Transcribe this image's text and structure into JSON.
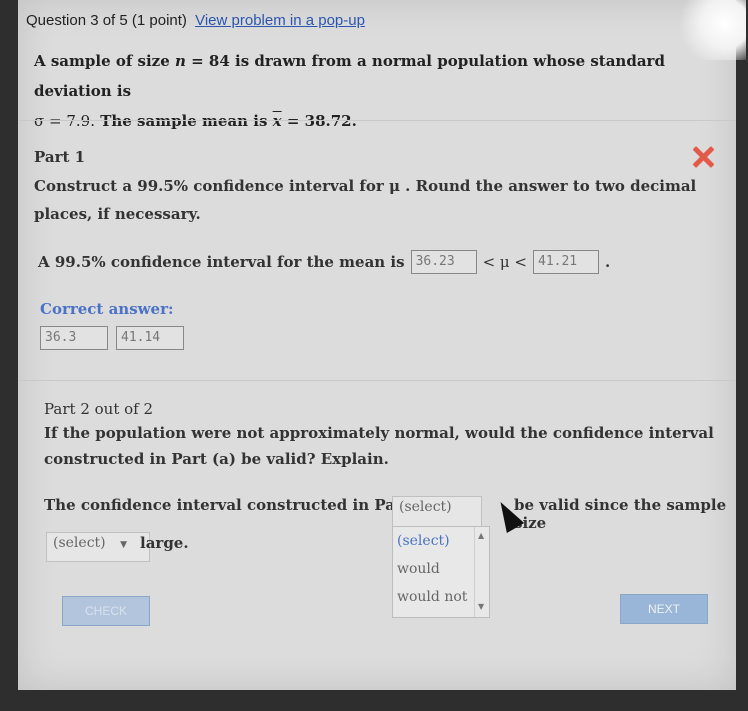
{
  "header": {
    "question": "Question 3 of 5 (1 point)",
    "popup_link": "View problem in a pop-up"
  },
  "problem": {
    "line1_pre": "A sample of size",
    "n_symbol": "n",
    "line1_mid": "= 84 is drawn from a normal population whose standard deviation is",
    "sigma_text": "σ = 7.9.",
    "line2_mid": "The sample mean is",
    "xbar_symbol": "x",
    "line2_end": "= 38.72."
  },
  "part1": {
    "title": "Part 1",
    "instruction": "Construct a 99.5% confidence interval for μ . Round the answer to two decimal places, if necessary.",
    "answer_prefix": "A 99.5% confidence interval for the mean is",
    "lower_value": "36.23",
    "middle": "< μ <",
    "upper_value": "41.21",
    "end": ".",
    "correct_label": "Correct answer:",
    "correct_lower": "36.3",
    "correct_upper": "41.14"
  },
  "part2": {
    "title": "Part 2 out of 2",
    "question": "If the population were not approximately normal, would the confidence interval constructed in Part (a) be valid? Explain.",
    "sentence_start": "The confidence interval constructed in Part (a)",
    "select1_value": "(select)",
    "sentence_mid": "be valid since the sample size",
    "select2_value": "(select)",
    "sentence_end": "large.",
    "dropdown_options": [
      "(select)",
      "would",
      "would not"
    ]
  },
  "buttons": {
    "check": "CHECK",
    "next": "NEXT"
  }
}
